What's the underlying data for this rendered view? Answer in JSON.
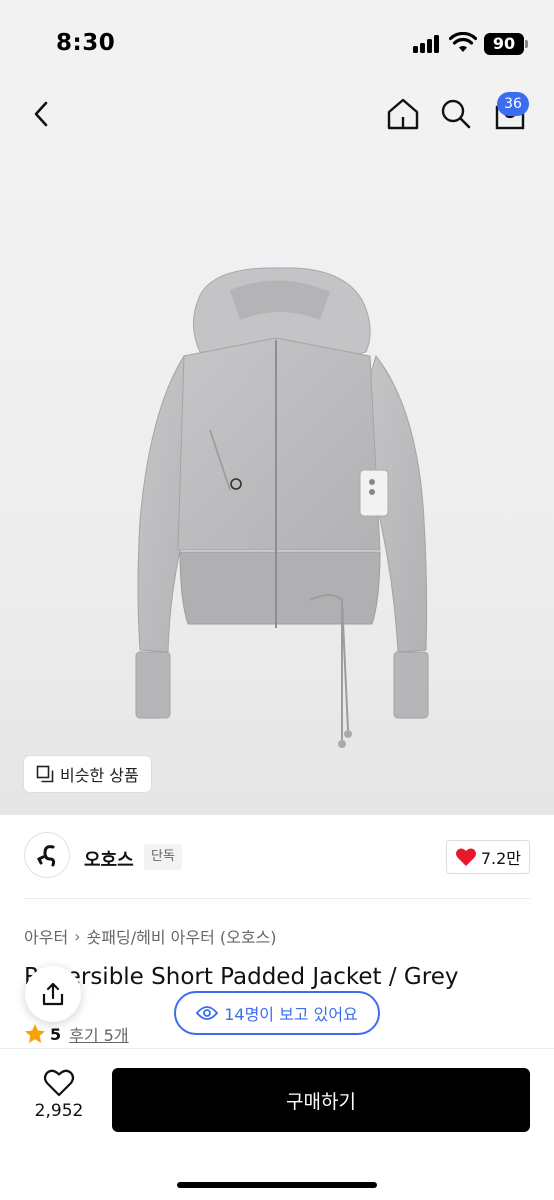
{
  "status_bar": {
    "time": "8:30",
    "battery": "90"
  },
  "header": {
    "icons": [
      "back-icon",
      "home-icon",
      "search-icon",
      "cart-icon"
    ],
    "cart_count": "36",
    "accent_color": "#3a6df0"
  },
  "hero": {
    "similar_products_label": "비슷한 상품"
  },
  "brand": {
    "name": "오호스",
    "tag": "단독",
    "like_count": "7.2만"
  },
  "breadcrumb": {
    "category": "아우터",
    "subcategory": "숏패딩/헤비 아우터 (오호스)"
  },
  "product": {
    "title": "Reversible Short Padded Jacket / Grey",
    "rating": "5",
    "review_link": "후기 5개"
  },
  "viewers_label": "14명이 보고 있어요",
  "bottom_bar": {
    "wish_count": "2,952",
    "buy_label": "구매하기"
  }
}
